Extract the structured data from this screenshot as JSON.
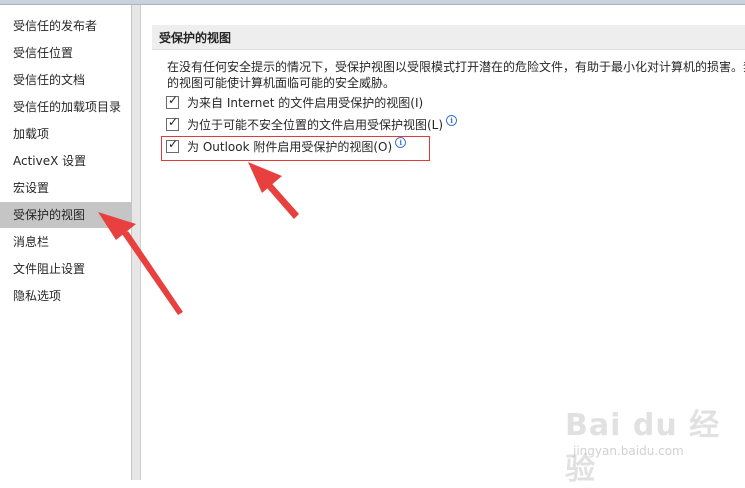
{
  "sidebar": {
    "items": [
      {
        "label": "受信任的发布者"
      },
      {
        "label": "受信任位置"
      },
      {
        "label": "受信任的文档"
      },
      {
        "label": "受信任的加载项目录"
      },
      {
        "label": "加载项"
      },
      {
        "label": "ActiveX 设置"
      },
      {
        "label": "宏设置"
      },
      {
        "label": "受保护的视图",
        "selected": true
      },
      {
        "label": "消息栏"
      },
      {
        "label": "文件阻止设置"
      },
      {
        "label": "隐私选项"
      }
    ]
  },
  "main": {
    "section_title": "受保护的视图",
    "description_line1": "在没有任何安全提示的情况下，受保护视图以受限模式打开潜在的危险文件，有助于最小化对计算机的损害。禁",
    "description_line2": "的视图可能使计算机面临可能的安全威胁。",
    "options": [
      {
        "label": "为来自 Internet 的文件启用受保护的视图(I)",
        "checked": true,
        "info": false
      },
      {
        "label": "为位于可能不安全位置的文件启用受保护视图(L)",
        "checked": true,
        "info": true
      },
      {
        "label": "为 Outlook 附件启用受保护的视图(O)",
        "checked": true,
        "info": true
      }
    ]
  },
  "colors": {
    "annotation_red": "#e23a3a",
    "selected_bg": "#c5c5c5"
  },
  "watermark": {
    "logo": "Bai du 经验",
    "url": "jingyan.baidu.com"
  }
}
